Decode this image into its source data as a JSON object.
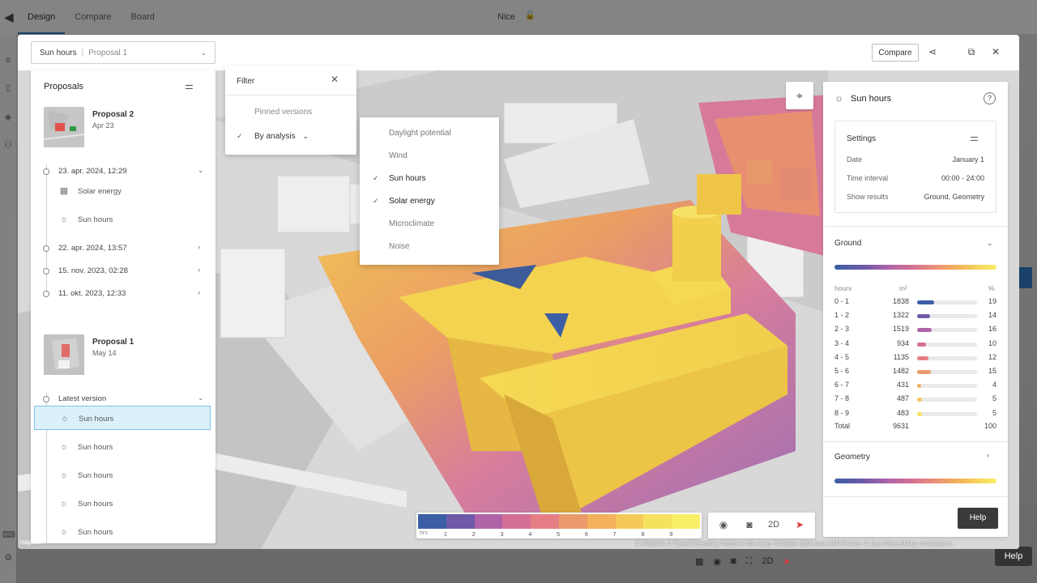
{
  "background": {
    "tabs": [
      "Design",
      "Compare",
      "Board"
    ],
    "project_name": "Nice",
    "help_label": "Help",
    "toolbar": {
      "mode_2d": "2D"
    }
  },
  "header": {
    "view_select": {
      "analysis": "Sun hours",
      "proposal": "Proposal 1"
    },
    "compare_label": "Compare"
  },
  "proposals_panel": {
    "title": "Proposals",
    "proposals": [
      {
        "name": "Proposal 2",
        "date": "Apr 23",
        "versions": [
          {
            "label": "23. apr. 2024, 12:29",
            "expanded": true,
            "items": [
              {
                "icon": "solar-panel-icon",
                "label": "Solar energy"
              },
              {
                "icon": "sun-icon",
                "label": "Sun hours"
              }
            ]
          },
          {
            "label": "22. apr. 2024, 13:57",
            "expanded": false
          },
          {
            "label": "15. nov. 2023, 02:28",
            "expanded": false
          },
          {
            "label": "11. okt. 2023, 12:33",
            "expanded": false
          }
        ]
      },
      {
        "name": "Proposal 1",
        "date": "May 14",
        "versions": [
          {
            "label": "Latest version",
            "expanded": true,
            "items": [
              {
                "icon": "sun-icon",
                "label": "Sun hours",
                "selected": true
              },
              {
                "icon": "sun-icon",
                "label": "Sun hours"
              },
              {
                "icon": "sun-icon",
                "label": "Sun hours"
              },
              {
                "icon": "sun-icon",
                "label": "Sun hours"
              },
              {
                "icon": "sun-icon",
                "label": "Sun hours"
              }
            ]
          }
        ]
      }
    ]
  },
  "filter_popup": {
    "title": "Filter",
    "options": [
      {
        "label": "Pinned versions",
        "checked": false
      },
      {
        "label": "By analysis",
        "checked": true
      }
    ]
  },
  "analysis_menu": {
    "options": [
      {
        "label": "Daylight potential",
        "checked": false
      },
      {
        "label": "Wind",
        "checked": false
      },
      {
        "label": "Sun hours",
        "checked": true
      },
      {
        "label": "Solar energy",
        "checked": true
      },
      {
        "label": "Microclimate",
        "checked": false
      },
      {
        "label": "Noise",
        "checked": false
      }
    ]
  },
  "results_panel": {
    "title": "Sun hours",
    "settings": {
      "title": "Settings",
      "rows": [
        {
          "label": "Date",
          "value": "January 1"
        },
        {
          "label": "Time interval",
          "value": "00:00 - 24:00"
        },
        {
          "label": "Show results",
          "value": "Ground, Geometry"
        }
      ]
    },
    "ground": {
      "title": "Ground",
      "headers": {
        "hours": "hours",
        "area": "m²",
        "pct": "%"
      },
      "rows": [
        {
          "range": "0 - 1",
          "area": "1838",
          "pct": 19,
          "color": "#3b5ea5"
        },
        {
          "range": "1 - 2",
          "area": "1322",
          "pct": 14,
          "color": "#6f5aa8"
        },
        {
          "range": "2 - 3",
          "area": "1519",
          "pct": 16,
          "color": "#b064a8"
        },
        {
          "range": "3 - 4",
          "area": "934",
          "pct": 10,
          "color": "#d56f94"
        },
        {
          "range": "4 - 5",
          "area": "1135",
          "pct": 12,
          "color": "#e67f85"
        },
        {
          "range": "5 - 6",
          "area": "1482",
          "pct": 15,
          "color": "#ea9a6c"
        },
        {
          "range": "6 - 7",
          "area": "431",
          "pct": 4,
          "color": "#f2b15a"
        },
        {
          "range": "7 - 8",
          "area": "487",
          "pct": 5,
          "color": "#f4c95a"
        },
        {
          "range": "8 - 9",
          "area": "483",
          "pct": 5,
          "color": "#f6e15e"
        }
      ],
      "total": {
        "label": "Total",
        "area": "9631",
        "pct": "100"
      }
    },
    "geometry": {
      "title": "Geometry"
    },
    "help_label": "Help"
  },
  "legend": {
    "unit": "hrs",
    "ticks": [
      "1",
      "2",
      "3",
      "4",
      "5",
      "6",
      "7",
      "8",
      "9"
    ],
    "colors": [
      "#3b5ea5",
      "#6f5aa8",
      "#b064a8",
      "#d56f94",
      "#e67f85",
      "#ea9a6c",
      "#f2b15a",
      "#f4c95a",
      "#f6e15e",
      "#f9ee67"
    ]
  },
  "view_tools": {
    "mode_2d": "2D"
  },
  "attribution": "© Mapbox © OpenStreetMap  Improve this map  Contains data from IGN France  © OpenStreetMap contributors",
  "mapbox_logo": "mapbox"
}
